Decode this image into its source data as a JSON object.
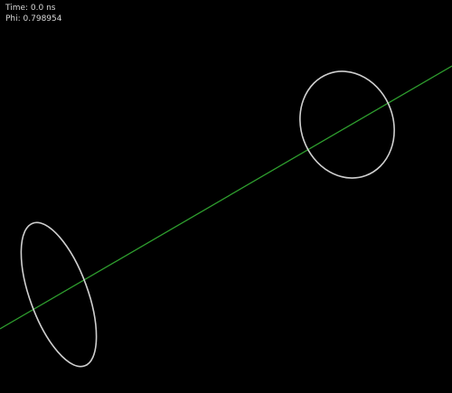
{
  "readouts": {
    "time": "Time: 0.0 ns",
    "phi": "Phi: 0.798954"
  },
  "colors": {
    "background": "#000000",
    "text": "#d8d8d8",
    "beam_line": "#2e9e2e",
    "ring": "#cfcfcf"
  }
}
